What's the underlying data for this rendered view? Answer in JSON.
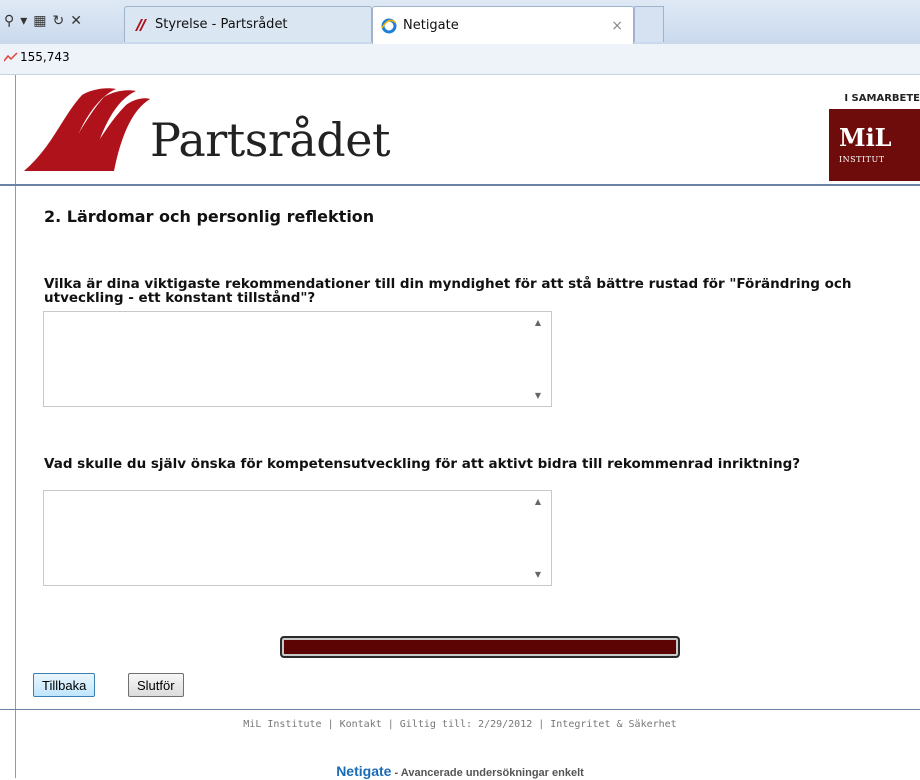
{
  "browser": {
    "tabs": [
      {
        "label": "Styrelse - Partsrådet",
        "active": false
      },
      {
        "label": "Netigate",
        "active": true
      }
    ],
    "favorites": [
      {
        "label": "155,743"
      }
    ]
  },
  "header": {
    "logo_text": "Partsrådet",
    "partner_label": "I SAMARBETE",
    "partner_logo": "MiL",
    "partner_sub": "INSTITUT"
  },
  "section": {
    "title": "2. Lärdomar och personlig reflektion"
  },
  "questions": [
    {
      "text": "Vilka är dina viktigaste rekommendationer till din myndighet för att stå bättre rustad för \"Förändring och utveckling - ett konstant tillstånd\"?",
      "value": ""
    },
    {
      "text": "Vad skulle du själv önska för kompetensutveckling för att aktivt bidra till rekommenrad inriktning?",
      "value": ""
    }
  ],
  "progress": {
    "percent": 100
  },
  "buttons": {
    "back": "Tillbaka",
    "finish": "Slutför"
  },
  "footer": {
    "links": [
      "MiL Institute",
      "Kontakt",
      "Giltig till: 2/29/2012",
      "Integritet & Säkerhet"
    ],
    "separator": "|",
    "brand": "Netigate",
    "dash": " - ",
    "tagline": "Avancerade undersökningar enkelt"
  },
  "colors": {
    "brand_red": "#6e0b0b",
    "progress": "#5c0303",
    "netigate_blue": "#1a6bb5"
  }
}
